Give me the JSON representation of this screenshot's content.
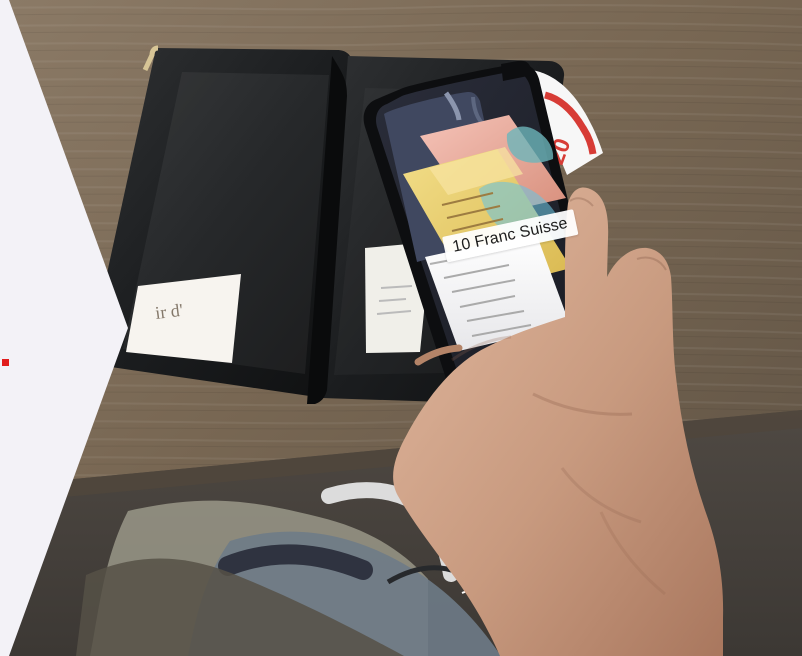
{
  "scene": {
    "ar_label": "10 Franc Suisse"
  },
  "colors": {
    "accent": "#e11d1d",
    "panel": "#f3f2f7",
    "table": "#7a6a56"
  }
}
